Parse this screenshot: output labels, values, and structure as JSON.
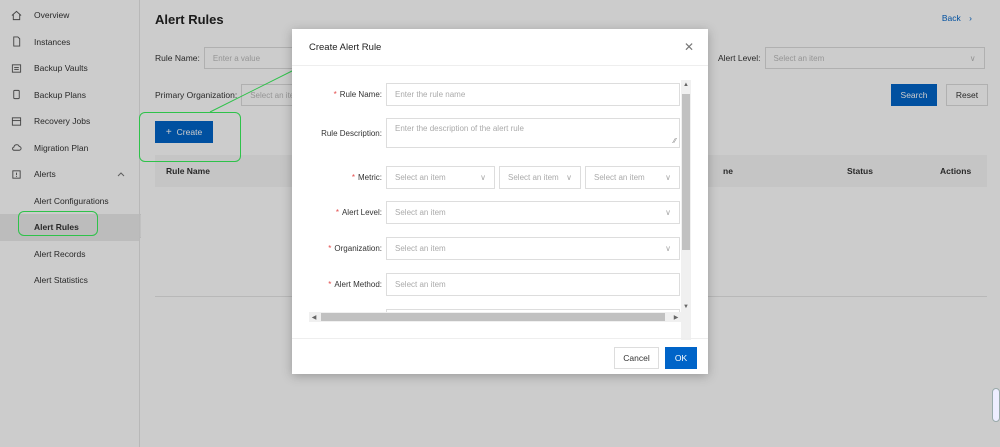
{
  "sidebar": {
    "items": [
      {
        "label": "Overview",
        "icon": "home-icon"
      },
      {
        "label": "Instances",
        "icon": "file-icon"
      },
      {
        "label": "Backup Vaults",
        "icon": "vault-icon"
      },
      {
        "label": "Backup Plans",
        "icon": "plan-icon"
      },
      {
        "label": "Recovery Jobs",
        "icon": "recovery-icon"
      },
      {
        "label": "Migration Plan",
        "icon": "cloud-icon"
      },
      {
        "label": "Alerts",
        "icon": "alert-icon"
      }
    ],
    "alerts_children": [
      {
        "label": "Alert Configurations"
      },
      {
        "label": "Alert Rules"
      },
      {
        "label": "Alert Records"
      },
      {
        "label": "Alert Statistics"
      }
    ]
  },
  "page": {
    "title": "Alert Rules",
    "back": "Back",
    "filters": {
      "rule_name_label": "Rule Name",
      "rule_name_placeholder": "Enter a value",
      "alert_level_label": "Alert Level",
      "alert_level_placeholder": "Select an item",
      "primary_org_label": "Primary Organization",
      "primary_org_placeholder": "Select an item"
    },
    "search_button": "Search",
    "reset_button": "Reset",
    "create_button": "Create",
    "table_columns": {
      "rule_name": "Rule Name",
      "name_fragment": "ne",
      "status": "Status",
      "actions": "Actions"
    }
  },
  "modal": {
    "title": "Create Alert Rule",
    "fields": {
      "rule_name": {
        "label": "Rule Name",
        "placeholder": "Enter the rule name"
      },
      "rule_description": {
        "label": "Rule Description",
        "placeholder": "Enter the description of the alert rule"
      },
      "metric": {
        "label": "Metric",
        "options": [
          "Select an item",
          "Select an item",
          "Select an item"
        ]
      },
      "alert_level": {
        "label": "Alert Level",
        "placeholder": "Select an item"
      },
      "organization": {
        "label": "Organization",
        "placeholder": "Select an item"
      },
      "alert_method": {
        "label": "Alert Method",
        "placeholder": "Select an item"
      }
    },
    "cancel_button": "Cancel",
    "ok_button": "OK"
  },
  "colors": {
    "primary": "#0064c8",
    "annotation": "#2ec24a",
    "required": "#e34c4c"
  }
}
